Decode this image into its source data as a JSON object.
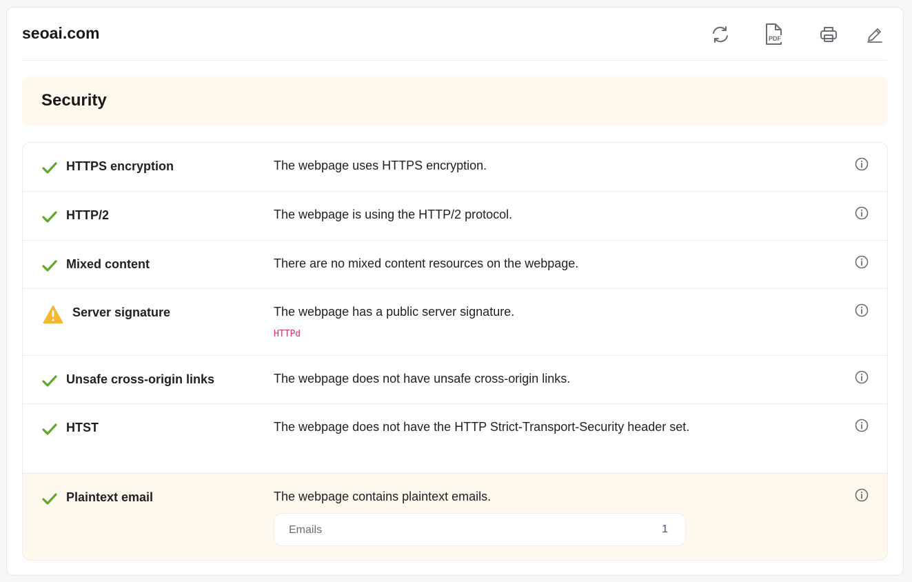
{
  "header": {
    "site_title": "seoai.com",
    "tools": [
      {
        "name": "refresh-icon"
      },
      {
        "name": "pdf-icon",
        "label": "PDF"
      },
      {
        "name": "print-icon"
      },
      {
        "name": "edit-icon"
      }
    ]
  },
  "section": {
    "title": "Security"
  },
  "colors": {
    "pass": "#5fa82d",
    "warning": "#f5b731",
    "highlight_bg": "#fef9ec",
    "code": "#d6336c"
  },
  "checks": [
    {
      "status": "pass",
      "name": "HTTPS encryption",
      "description": "The webpage uses HTTPS encryption."
    },
    {
      "status": "pass",
      "name": "HTTP/2",
      "description": "The webpage is using the HTTP/2 protocol."
    },
    {
      "status": "pass",
      "name": "Mixed content",
      "description": "There are no mixed content resources on the webpage."
    },
    {
      "status": "warning",
      "name": "Server signature",
      "description": "The webpage has a public server signature.",
      "code": "HTTPd"
    },
    {
      "status": "pass",
      "name": "Unsafe cross-origin links",
      "description": "The webpage does not have unsafe cross-origin links."
    },
    {
      "status": "pass",
      "name": "HTST",
      "description": "The webpage does not have the HTTP Strict-Transport-Security header set."
    },
    {
      "status": "pass",
      "name": "Plaintext email",
      "description": "The webpage contains plaintext emails.",
      "detail_label": "Emails",
      "detail_count": "1"
    }
  ]
}
